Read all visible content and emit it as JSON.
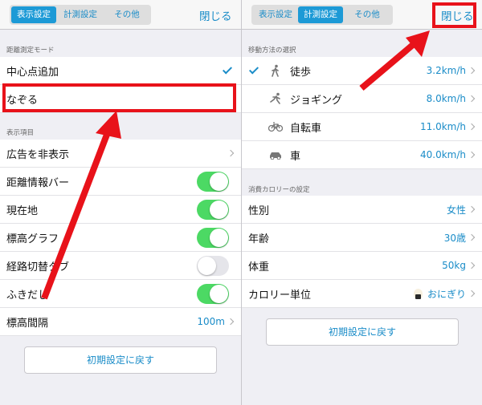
{
  "left": {
    "tabs": [
      "表示設定",
      "計測設定",
      "その他"
    ],
    "close_label": "閉じる",
    "section1_header": "距離測定モード",
    "mode_items": [
      "中心点追加",
      "なぞる"
    ],
    "section2_header": "表示項目",
    "items": [
      {
        "label": "広告を非表示",
        "type": "chevron"
      },
      {
        "label": "距離情報バー",
        "type": "toggle",
        "on": true
      },
      {
        "label": "現在地",
        "type": "toggle",
        "on": true
      },
      {
        "label": "標高グラフ",
        "type": "toggle",
        "on": true
      },
      {
        "label": "経路切替タブ",
        "type": "toggle",
        "on": false
      },
      {
        "label": "ふきだし",
        "type": "toggle",
        "on": true
      }
    ],
    "elevation": {
      "label": "標高間隔",
      "value": "100m"
    },
    "reset_label": "初期設定に戻す"
  },
  "right": {
    "tabs": [
      "表示設定",
      "計測設定",
      "その他"
    ],
    "close_label": "閉じる",
    "section1_header": "移動方法の選択",
    "methods": [
      {
        "label": "徒歩",
        "value": "3.2km/h",
        "icon": "walking-icon",
        "checked": true
      },
      {
        "label": "ジョギング",
        "value": "8.0km/h",
        "icon": "running-icon",
        "checked": false
      },
      {
        "label": "自転車",
        "value": "11.0km/h",
        "icon": "bicycle-icon",
        "checked": false
      },
      {
        "label": "車",
        "value": "40.0km/h",
        "icon": "car-icon",
        "checked": false
      }
    ],
    "section2_header": "消費カロリーの設定",
    "calorie": [
      {
        "label": "性別",
        "value": "女性"
      },
      {
        "label": "年齢",
        "value": "30歳"
      },
      {
        "label": "体重",
        "value": "50kg"
      },
      {
        "label": "カロリー単位",
        "value": "おにぎり"
      }
    ],
    "reset_label": "初期設定に戻す"
  },
  "colors": {
    "accent": "#1a8cc8",
    "toggle_on": "#4cd964",
    "annotation": "#e8121a"
  }
}
